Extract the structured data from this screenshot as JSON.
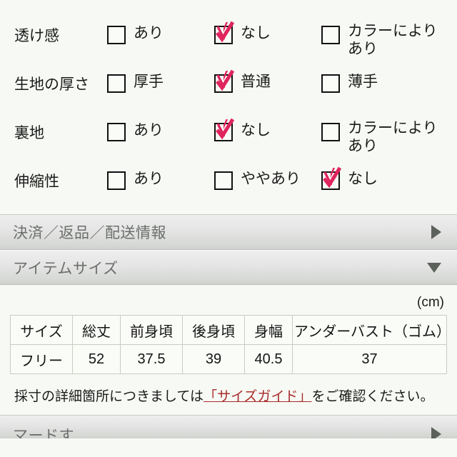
{
  "spec": {
    "rows": [
      {
        "label": "透け感",
        "options": [
          {
            "text": "あり",
            "checked": false
          },
          {
            "text": "なし",
            "checked": true
          },
          {
            "text": "カラーにより あり",
            "checked": false,
            "two_line": true
          }
        ]
      },
      {
        "label": "生地の厚さ",
        "options": [
          {
            "text": "厚手",
            "checked": false
          },
          {
            "text": "普通",
            "checked": true
          },
          {
            "text": "薄手",
            "checked": false
          }
        ]
      },
      {
        "label": "裏地",
        "options": [
          {
            "text": "あり",
            "checked": false
          },
          {
            "text": "なし",
            "checked": true
          },
          {
            "text": "カラーにより あり",
            "checked": false,
            "two_line": true
          }
        ]
      },
      {
        "label": "伸縮性",
        "options": [
          {
            "text": "あり",
            "checked": false
          },
          {
            "text": "ややあり",
            "checked": false
          },
          {
            "text": "なし",
            "checked": true
          }
        ]
      }
    ]
  },
  "accordions": {
    "payment": {
      "title": "決済／返品／配送情報",
      "state": "collapsed"
    },
    "item_size": {
      "title": "アイテムサイズ",
      "state": "expanded"
    },
    "bottom_partial": {
      "title": "マードす",
      "state": "collapsed"
    }
  },
  "size_section": {
    "unit": "(cm)",
    "headers": [
      "サイズ",
      "総丈",
      "前身頃",
      "後身頃",
      "身幅",
      "アンダーバスト（ゴム）"
    ],
    "rows": [
      [
        "フリー",
        "52",
        "37.5",
        "39",
        "40.5",
        "37"
      ]
    ],
    "note_prefix": "採寸の詳細箇所につきましては",
    "note_link": "「サイズガイド」",
    "note_suffix": "をご確認ください。"
  },
  "colors": {
    "background": "#f7faf4",
    "check_mark": "#e0245e",
    "link": "#a82a2a",
    "accordion_text": "#6b6f6b"
  }
}
